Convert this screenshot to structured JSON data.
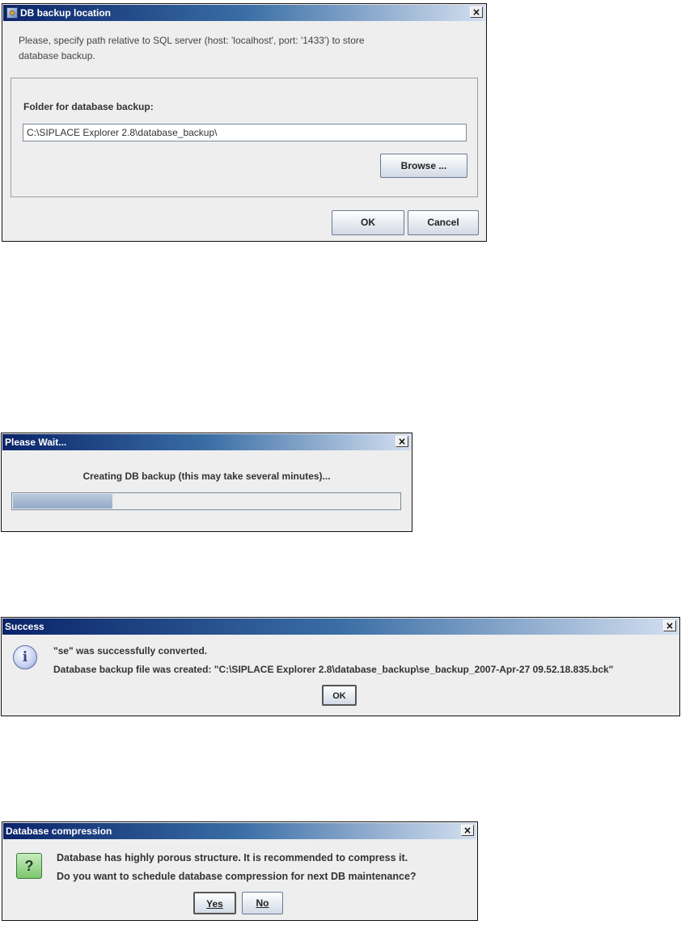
{
  "backup_dialog": {
    "title": "DB backup location",
    "close_label": "×",
    "description_line1": "Please, specify path relative to SQL server (host: 'localhost', port: '1433') to store",
    "description_line2": "database backup.",
    "folder_label": "Folder for database backup:",
    "folder_value": "C:\\SIPLACE Explorer 2.8\\database_backup\\",
    "browse_label": "Browse ...",
    "ok_label": "OK",
    "cancel_label": "Cancel"
  },
  "wait_dialog": {
    "title": "Please Wait...",
    "close_label": "×",
    "message": "Creating DB backup (this may take several minutes)...",
    "progress": 0.26
  },
  "success_dialog": {
    "title": "Success",
    "close_label": "×",
    "line1": "\"se\" was successfully converted.",
    "line2": "Database backup file was created: \"C:\\SIPLACE Explorer 2.8\\database_backup\\se_backup_2007-Apr-27 09.52.18.835.bck\"",
    "ok_label": "OK",
    "icon": "info-icon"
  },
  "compression_dialog": {
    "title": "Database compression",
    "close_label": "×",
    "line1": "Database has highly porous structure. It is recommended to compress it.",
    "line2": "Do you want to schedule database compression for next DB maintenance?",
    "yes_label": "Yes",
    "no_label": "No",
    "icon": "question-icon"
  }
}
